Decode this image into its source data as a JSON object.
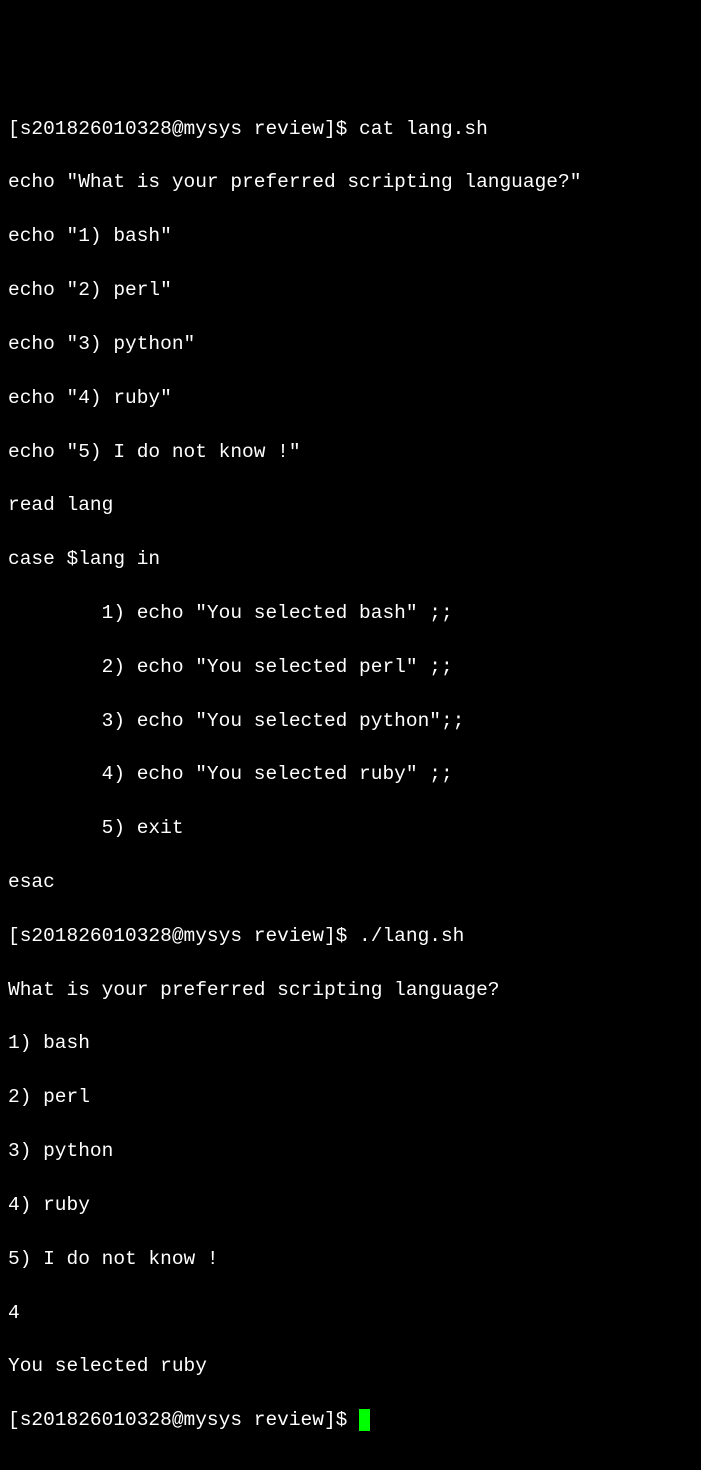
{
  "lines": [
    "[s201826010328@mysys review]$ cat lang.sh",
    "echo \"What is your preferred scripting language?\"",
    "echo \"1) bash\"",
    "echo \"2) perl\"",
    "echo \"3) python\"",
    "echo \"4) ruby\"",
    "echo \"5) I do not know !\"",
    "read lang",
    "case $lang in",
    "        1) echo \"You selected bash\" ;;",
    "        2) echo \"You selected perl\" ;;",
    "        3) echo \"You selected python\";;",
    "        4) echo \"You selected ruby\" ;;",
    "        5) exit",
    "esac",
    "[s201826010328@mysys review]$ ./lang.sh",
    "What is your preferred scripting language?",
    "1) bash",
    "2) perl",
    "3) python",
    "4) ruby",
    "5) I do not know !",
    "4",
    "You selected ruby",
    "[s201826010328@mysys review]$ "
  ]
}
